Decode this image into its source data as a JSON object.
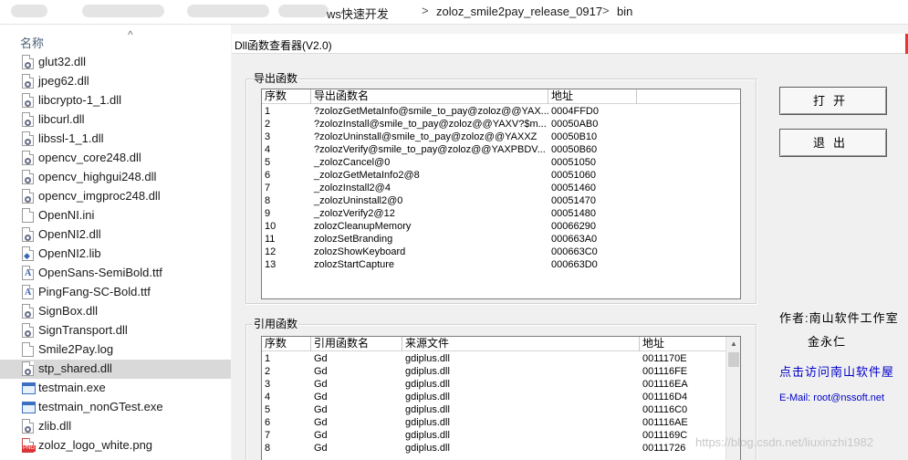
{
  "breadcrumb": {
    "items": [
      "ws快速开发",
      "zoloz_smile2pay_release_0917",
      "bin"
    ],
    "separator": ">"
  },
  "explorer": {
    "column_name": "名称",
    "selected_file": "stp_shared.dll",
    "files": [
      {
        "name": "glut32.dll",
        "icon": "dll-icon"
      },
      {
        "name": "jpeg62.dll",
        "icon": "dll-icon"
      },
      {
        "name": "libcrypto-1_1.dll",
        "icon": "dll-icon"
      },
      {
        "name": "libcurl.dll",
        "icon": "dll-icon"
      },
      {
        "name": "libssl-1_1.dll",
        "icon": "dll-icon"
      },
      {
        "name": "opencv_core248.dll",
        "icon": "dll-icon"
      },
      {
        "name": "opencv_highgui248.dll",
        "icon": "dll-icon"
      },
      {
        "name": "opencv_imgproc248.dll",
        "icon": "dll-icon"
      },
      {
        "name": "OpenNI.ini",
        "icon": "ini-file-icon"
      },
      {
        "name": "OpenNI2.dll",
        "icon": "dll-icon"
      },
      {
        "name": "OpenNI2.lib",
        "icon": "lib-file-icon"
      },
      {
        "name": "OpenSans-SemiBold.ttf",
        "icon": "font-file-icon"
      },
      {
        "name": "PingFang-SC-Bold.ttf",
        "icon": "font-file-icon"
      },
      {
        "name": "SignBox.dll",
        "icon": "dll-icon"
      },
      {
        "name": "SignTransport.dll",
        "icon": "dll-icon"
      },
      {
        "name": "Smile2Pay.log",
        "icon": "text-file-icon"
      },
      {
        "name": "stp_shared.dll",
        "icon": "dll-icon"
      },
      {
        "name": "testmain.exe",
        "icon": "exe-icon"
      },
      {
        "name": "testmain_nonGTest.exe",
        "icon": "exe-icon"
      },
      {
        "name": "zlib.dll",
        "icon": "dll-icon"
      },
      {
        "name": "zoloz_logo_white.png",
        "icon": "png-file-icon"
      }
    ]
  },
  "dialog": {
    "title": "Dll函数查看器(V2.0)",
    "accent_color": "#e83636",
    "export_group": {
      "title": "导出函数",
      "headers": [
        "序数",
        "导出函数名",
        "地址",
        ""
      ],
      "rows": [
        [
          "1",
          "?zolozGetMetaInfo@smile_to_pay@zoloz@@YAX...",
          "0004FFD0"
        ],
        [
          "2",
          "?zolozInstall@smile_to_pay@zoloz@@YAXV?$m...",
          "00050AB0"
        ],
        [
          "3",
          "?zolozUninstall@smile_to_pay@zoloz@@YAXXZ",
          "00050B10"
        ],
        [
          "4",
          "?zolozVerify@smile_to_pay@zoloz@@YAXPBDV...",
          "00050B60"
        ],
        [
          "5",
          "_zolozCancel@0",
          "00051050"
        ],
        [
          "6",
          "_zolozGetMetaInfo2@8",
          "00051060"
        ],
        [
          "7",
          "_zolozInstall2@4",
          "00051460"
        ],
        [
          "8",
          "_zolozUninstall2@0",
          "00051470"
        ],
        [
          "9",
          "_zolozVerify2@12",
          "00051480"
        ],
        [
          "10",
          "zolozCleanupMemory",
          "00066290"
        ],
        [
          "11",
          "zolozSetBranding",
          "000663A0"
        ],
        [
          "12",
          "zolozShowKeyboard",
          "000663C0"
        ],
        [
          "13",
          "zolozStartCapture",
          "000663D0"
        ]
      ]
    },
    "import_group": {
      "title": "引用函数",
      "headers": [
        "序数",
        "引用函数名",
        "来源文件",
        "地址"
      ],
      "rows": [
        [
          "1",
          "Gd",
          "gdiplus.dll",
          "0011170E"
        ],
        [
          "2",
          "Gd",
          "gdiplus.dll",
          "001116FE"
        ],
        [
          "3",
          "Gd",
          "gdiplus.dll",
          "001116EA"
        ],
        [
          "4",
          "Gd",
          "gdiplus.dll",
          "001116D4"
        ],
        [
          "5",
          "Gd",
          "gdiplus.dll",
          "001116C0"
        ],
        [
          "6",
          "Gd",
          "gdiplus.dll",
          "001116AE"
        ],
        [
          "7",
          "Gd",
          "gdiplus.dll",
          "0011169C"
        ],
        [
          "8",
          "Gd",
          "gdiplus.dll",
          "00111726"
        ]
      ]
    },
    "buttons": {
      "open": "打开",
      "exit": "退出"
    },
    "info": {
      "author_label": "作者:南山软件工作室",
      "author_name": "金永仁",
      "visit_link": "点击访问南山软件屋",
      "email": "E-Mail: root@nssoft.net"
    },
    "link_color": "#0000cc"
  },
  "watermark": "https://blog.csdn.net/liuxinzhi1982"
}
